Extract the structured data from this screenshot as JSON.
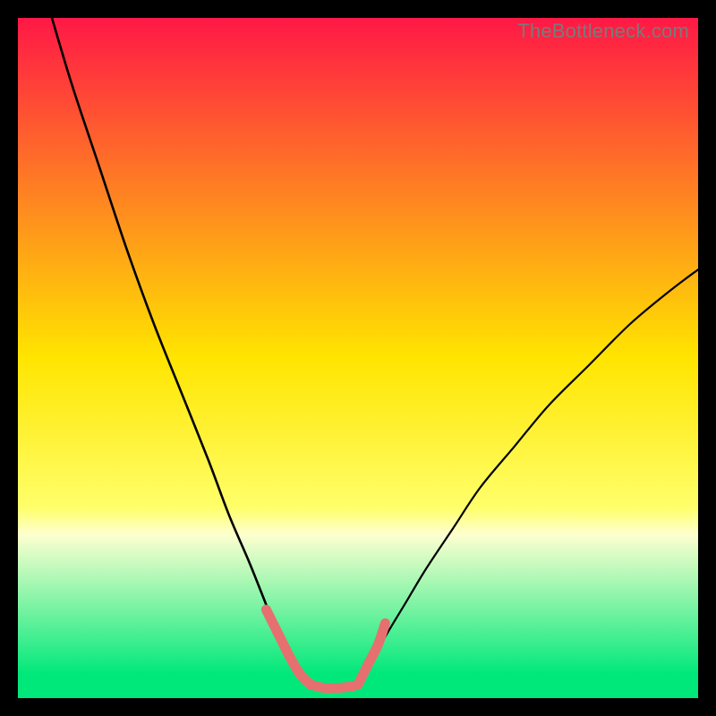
{
  "watermark": "TheBottleneck.com",
  "chart_data": {
    "type": "line",
    "title": "",
    "xlabel": "",
    "ylabel": "",
    "xlim": [
      0,
      100
    ],
    "ylim": [
      0,
      100
    ],
    "gradient_stops": [
      {
        "offset": 0.0,
        "color": "#ff1846"
      },
      {
        "offset": 0.5,
        "color": "#ffe500"
      },
      {
        "offset": 0.72,
        "color": "#ffff6a"
      },
      {
        "offset": 0.76,
        "color": "#fdffd0"
      },
      {
        "offset": 0.965,
        "color": "#00e87a"
      },
      {
        "offset": 1.0,
        "color": "#00e87a"
      }
    ],
    "series": [
      {
        "name": "left-curve",
        "x": [
          5,
          8,
          12,
          16,
          20,
          24,
          28,
          31,
          34,
          36,
          38,
          40,
          41.5,
          43
        ],
        "y": [
          100,
          90,
          78,
          66,
          55,
          45,
          35,
          27,
          20,
          15,
          10,
          6,
          3.5,
          2
        ]
      },
      {
        "name": "right-curve",
        "x": [
          50,
          52,
          54,
          57,
          60,
          64,
          68,
          73,
          78,
          84,
          90,
          96,
          100
        ],
        "y": [
          2,
          5,
          9,
          14,
          19,
          25,
          31,
          37,
          43,
          49,
          55,
          60,
          63
        ]
      },
      {
        "name": "trough",
        "x": [
          43,
          45,
          47,
          49,
          50
        ],
        "y": [
          2,
          1.5,
          1.5,
          1.7,
          2
        ]
      }
    ],
    "highlight_segments": [
      {
        "name": "left-descent-highlight",
        "x": [
          36.5,
          38,
          40,
          41.5,
          43
        ],
        "y": [
          13,
          10,
          6,
          3.5,
          2
        ]
      },
      {
        "name": "trough-highlight",
        "x": [
          43,
          45,
          47,
          49,
          50
        ],
        "y": [
          2,
          1.5,
          1.5,
          1.7,
          2
        ]
      },
      {
        "name": "right-ascent-highlight",
        "x": [
          50,
          51.5,
          53,
          54
        ],
        "y": [
          2,
          5,
          8,
          11
        ]
      }
    ],
    "curve_color": "#000000",
    "highlight_color": "#e6706f",
    "bottom_band": {
      "from_y": 0,
      "to_y": 3.5,
      "color": "#00e87a"
    }
  }
}
